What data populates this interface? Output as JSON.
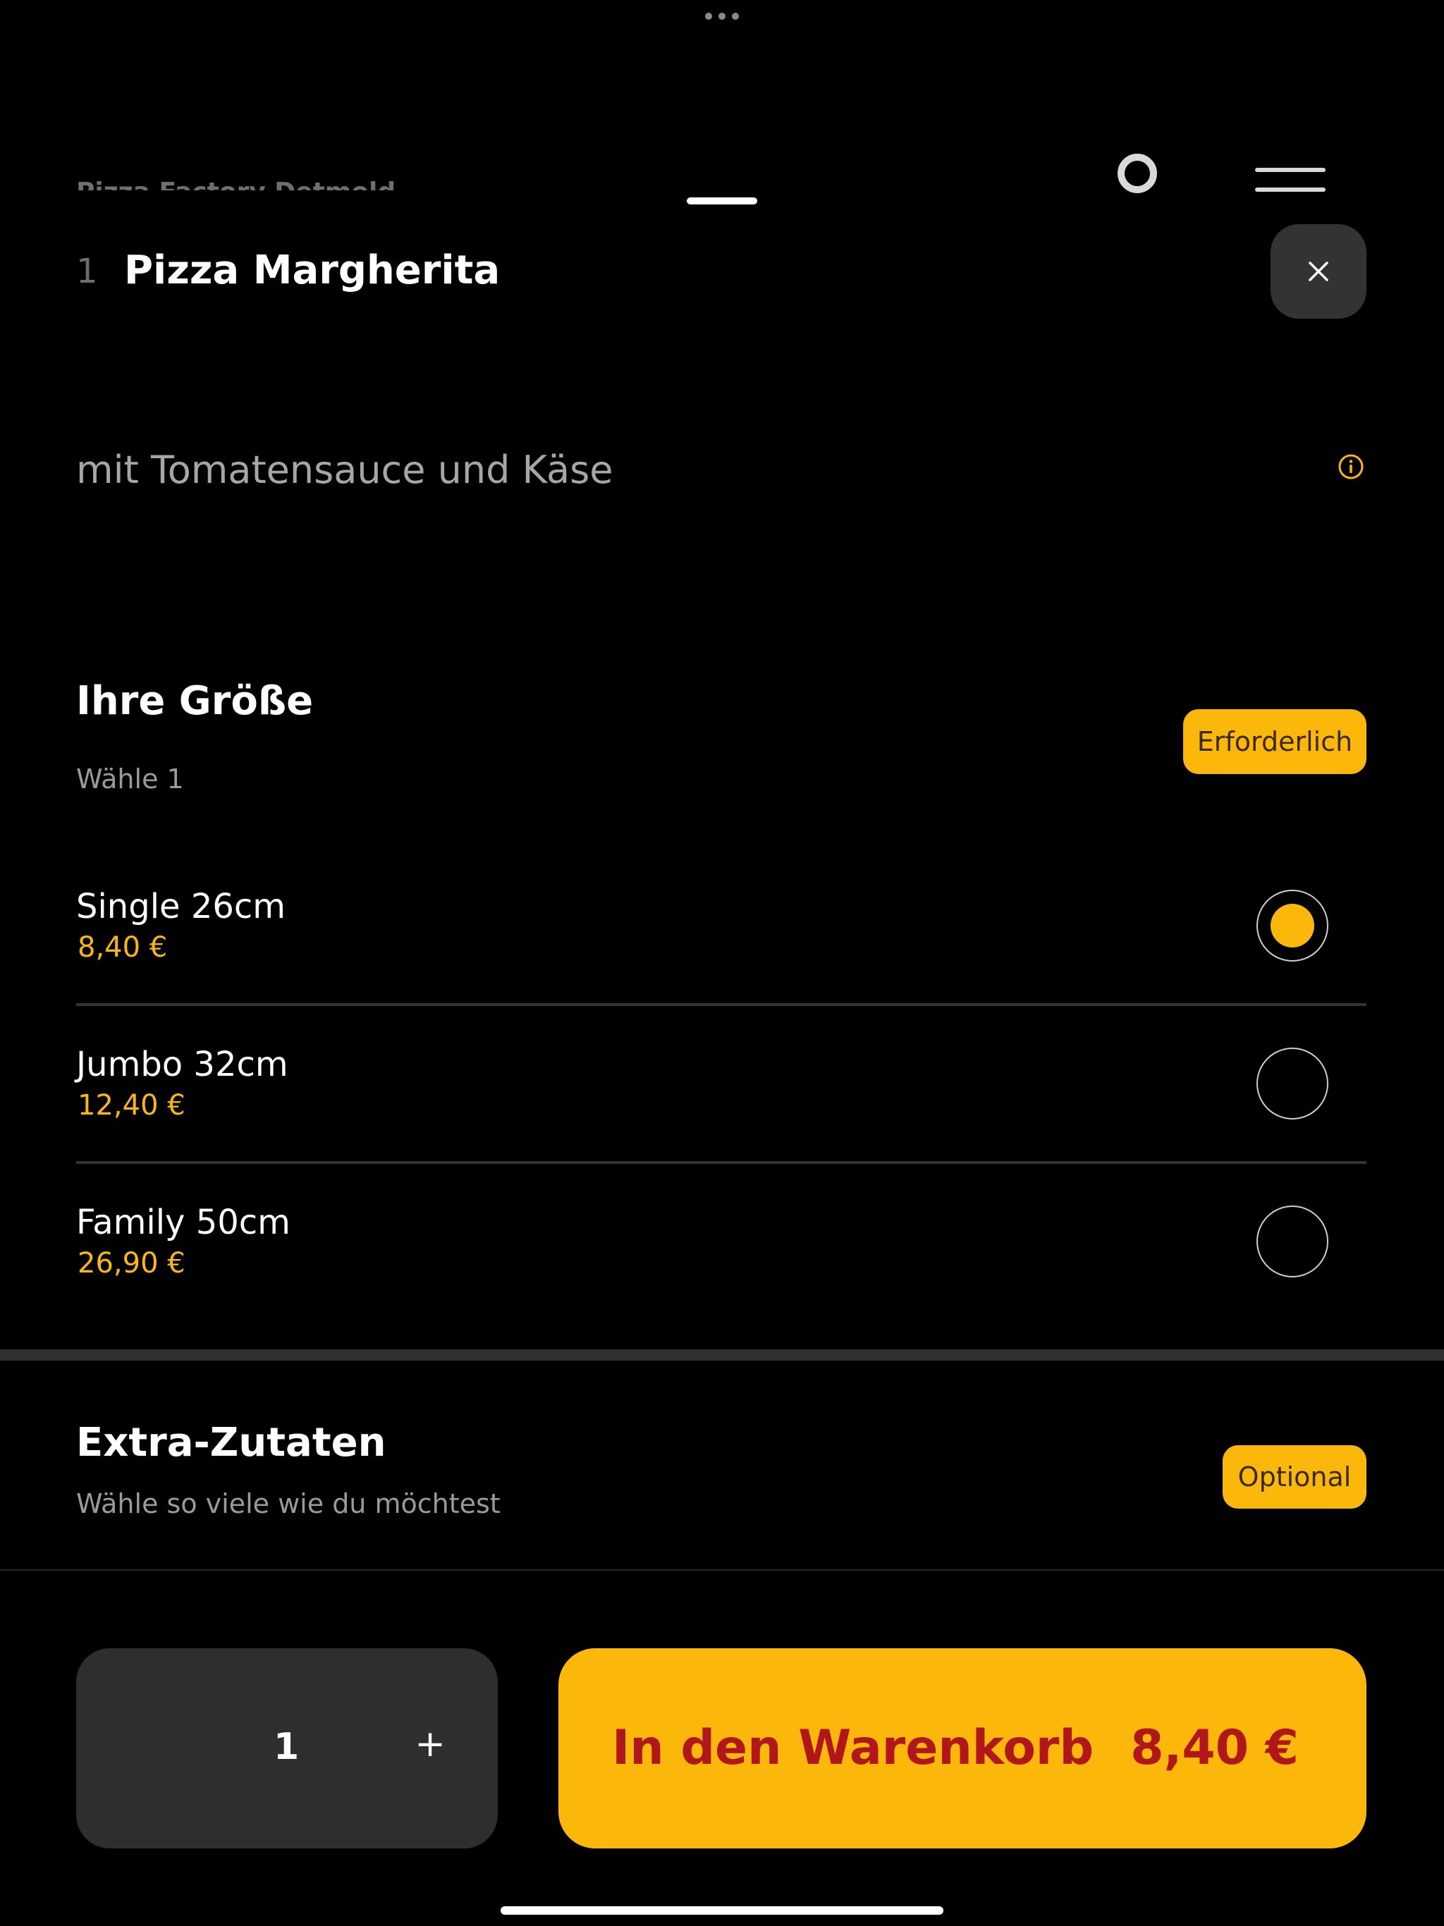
{
  "background": {
    "restaurant_name": "Pizza Factory Detmold"
  },
  "item": {
    "number": "1",
    "title": "Pizza Margherita",
    "description": "mit Tomatensauce und Käse"
  },
  "size_section": {
    "title": "Ihre Größe",
    "subtitle": "Wähle 1",
    "badge": "Erforderlich",
    "options": [
      {
        "name": "Single 26cm",
        "price": "8,40 €",
        "selected": true
      },
      {
        "name": "Jumbo 32cm",
        "price": "12,40 €",
        "selected": false
      },
      {
        "name": "Family 50cm",
        "price": "26,90 €",
        "selected": false
      }
    ]
  },
  "extras_section": {
    "title": "Extra-Zutaten",
    "subtitle": "Wähle so viele wie du möchtest",
    "badge": "Optional"
  },
  "footer": {
    "quantity": "1",
    "plus_symbol": "+",
    "cart_label": "In den Warenkorb",
    "cart_price": "8,40 €"
  },
  "icons": {
    "close": "close-icon",
    "info": "info-icon",
    "plus": "plus-icon"
  },
  "colors": {
    "accent": "#fbb80a",
    "cart_text": "#b0161a",
    "background": "#000000",
    "panel": "#2e2e2e"
  }
}
